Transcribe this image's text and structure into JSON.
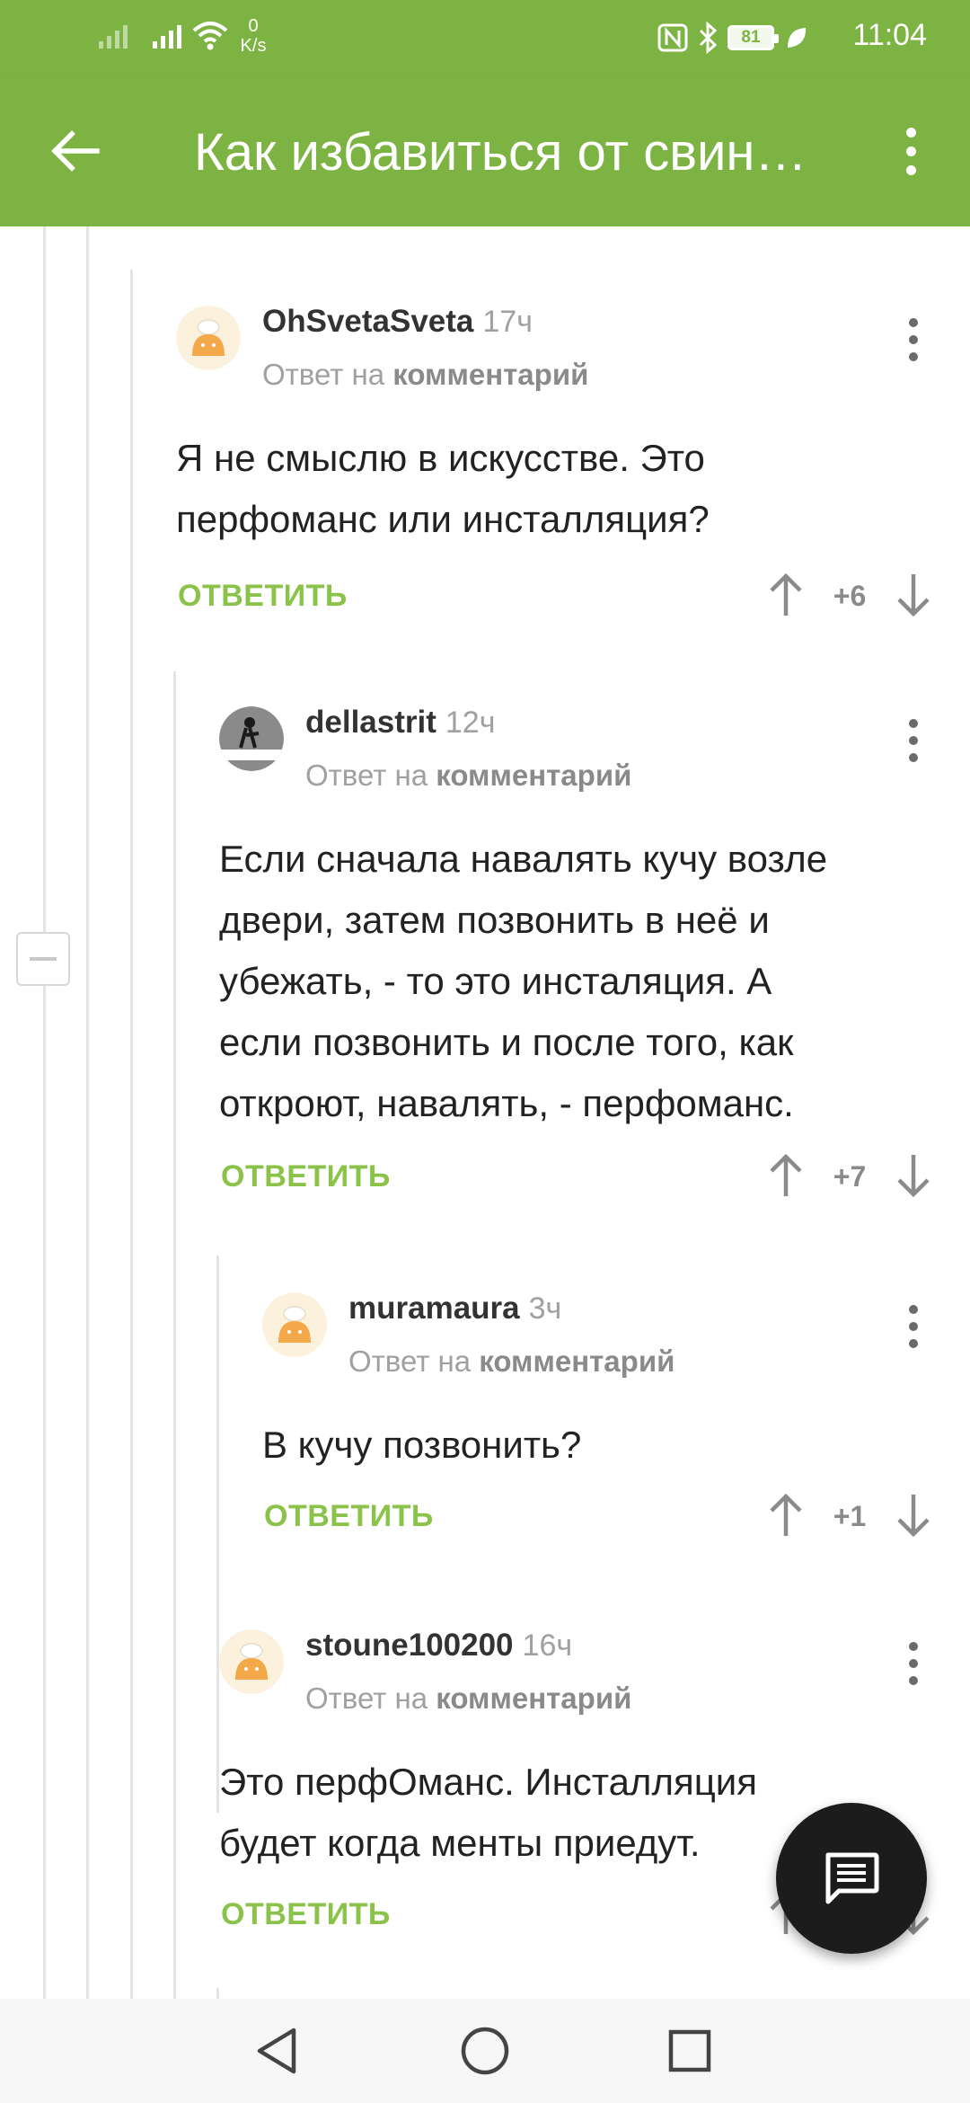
{
  "status_bar": {
    "net_speed_value": "0",
    "net_speed_unit": "K/s",
    "battery": "81",
    "time": "11:04"
  },
  "app_bar": {
    "title": "Как избавиться от свин…"
  },
  "comments": [
    {
      "author": "OhSvetaSveta",
      "time": "17ч",
      "reply_prefix": "Ответ на",
      "reply_link": "комментарий",
      "text_lines": [
        "Я не смыслю в искусстве. Это",
        "перфоманс или инсталляция?"
      ],
      "reply_label": "ОТВЕТИТЬ",
      "score": "+6"
    },
    {
      "author": "dellastrit",
      "time": "12ч",
      "reply_prefix": "Ответ на",
      "reply_link": "комментарий",
      "text_lines": [
        "Если сначала навалять кучу возле",
        "двери, затем позвонить в неё и",
        "убежать, - то это инсталяция. А",
        "если позвонить и после того, как",
        "откроют, навалять, - перфоманс."
      ],
      "reply_label": "ОТВЕТИТЬ",
      "score": "+7"
    },
    {
      "author": "muramaura",
      "time": "3ч",
      "reply_prefix": "Ответ на",
      "reply_link": "комментарий",
      "text_lines": [
        "В кучу позвонить?"
      ],
      "reply_label": "ОТВЕТИТЬ",
      "score": "+1"
    },
    {
      "author": "stoune100200",
      "time": "16ч",
      "reply_prefix": "Ответ на",
      "reply_link": "комментарий",
      "text_lines": [
        "Это перфОманс. Инсталляция",
        "будет когда менты приедут."
      ],
      "reply_label": "ОТВЕТИТЬ",
      "score": ""
    }
  ],
  "icons": {
    "back": "arrow-left",
    "overflow": "three-dots-vertical",
    "vote_up": "arrow-up",
    "vote_down": "arrow-down",
    "fab": "comment-bubble",
    "nav_back": "triangle-left",
    "nav_home": "circle",
    "nav_recents": "square"
  },
  "colors": {
    "brand_green": "#7cb342",
    "reply_green": "#8bc34a",
    "fab": "#1c1c1c"
  }
}
